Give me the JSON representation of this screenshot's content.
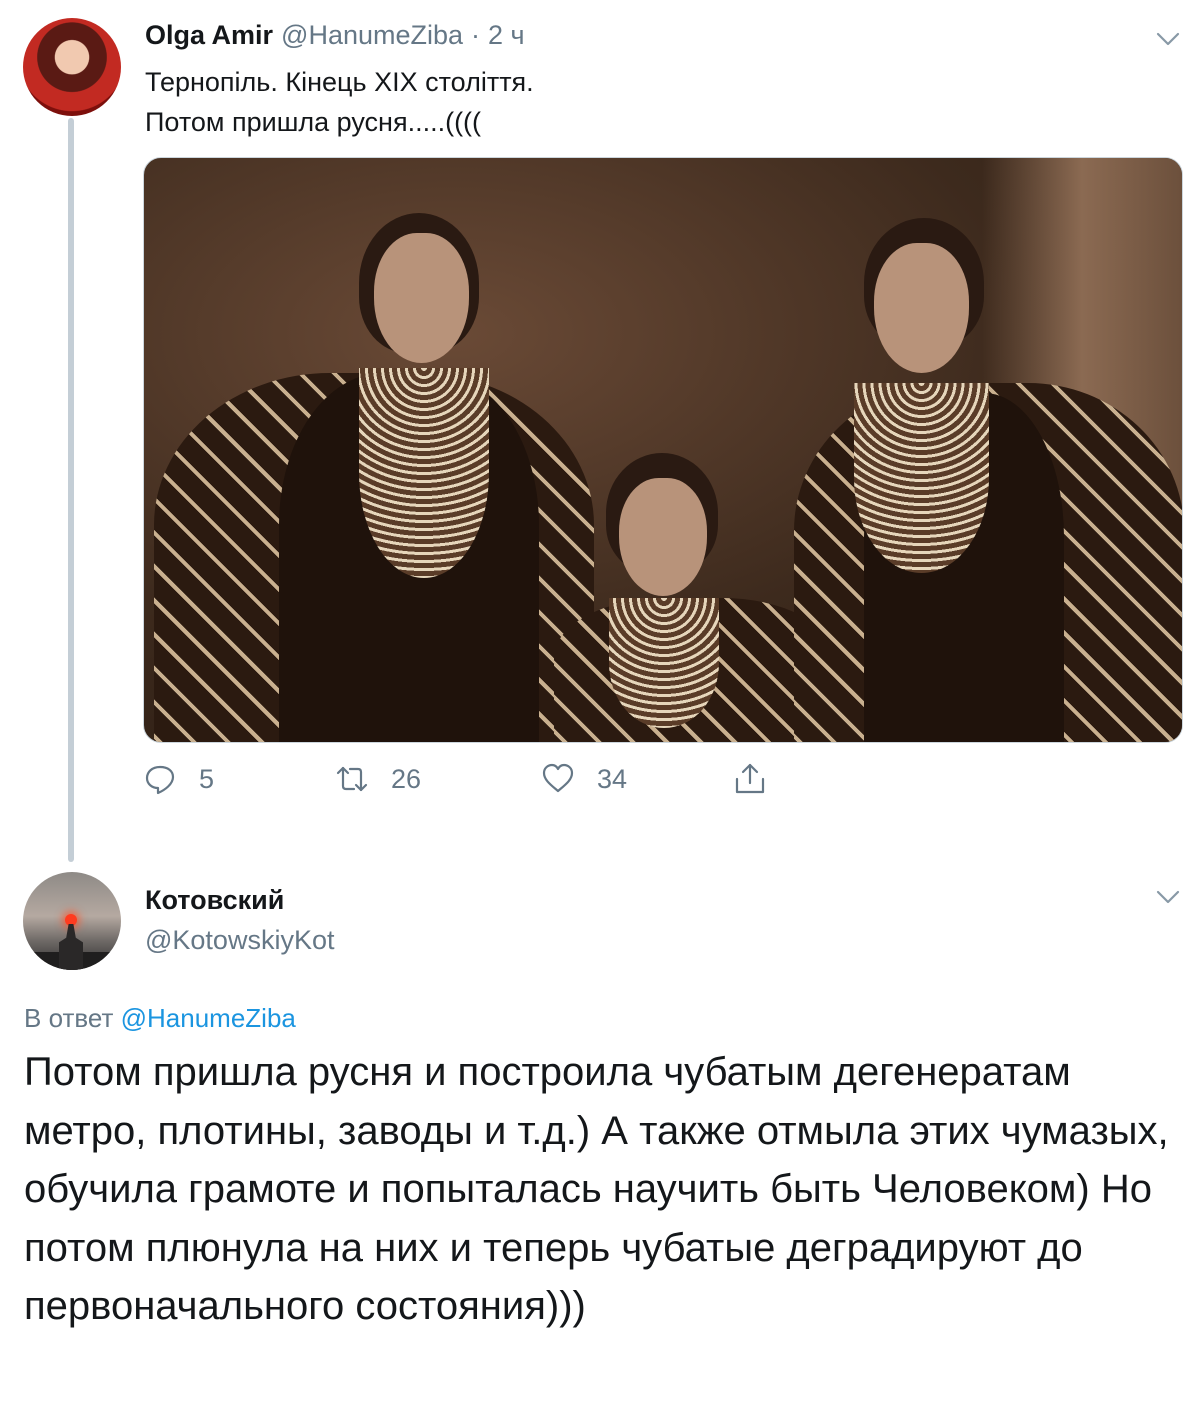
{
  "tweet1": {
    "display_name": "Olga Amir",
    "handle": "@HanumeZiba",
    "separator": "·",
    "time": "2 ч",
    "text_line1": "Тернопіль. Кінець XIX століття.",
    "text_line2": "Потом пришла русня.....((((",
    "photo_icon": "photo",
    "actions": {
      "reply_count": "5",
      "retweet_count": "26",
      "like_count": "34"
    }
  },
  "tweet2": {
    "display_name": "Котовский",
    "handle": "@KotowskiyKot",
    "reply_prefix": "В ответ",
    "reply_mention": "@HanumeZiba",
    "text": "Потом пришла русня и построила чубатым дегенератам метро, плотины, заводы и т.д.) А также отмыла этих чумазых, обучила грамоте и попыталась научить быть Человеком) Но потом плюнула на них и теперь чубатые деградируют до первоначального состояния)))"
  },
  "colors": {
    "text": "#14171a",
    "muted": "#657786",
    "link": "#1b95e0",
    "thread_line": "#c4ced6"
  }
}
